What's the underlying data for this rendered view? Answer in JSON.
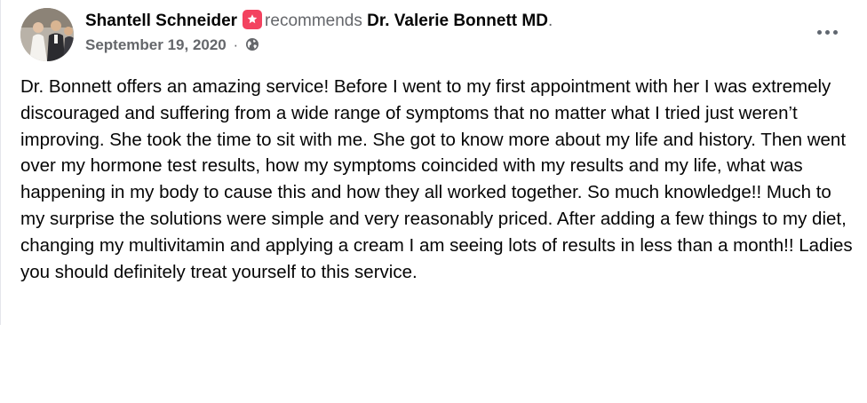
{
  "post": {
    "author": "Shantell Schneider",
    "recommend_verb": "recommends",
    "page_name": "Dr. Valerie Bonnett MD",
    "page_suffix": ".",
    "date": "September 19, 2020",
    "separator": "·",
    "audience_icon": "globe-icon",
    "recommend_badge_icon": "star-recommendation-icon",
    "badge_color": "#f3425f",
    "more_icon": "ellipsis-icon",
    "body": "Dr. Bonnett offers an amazing service! Before I went to my first appointment with her I was extremely discouraged and suffering from a wide range of symptoms that no matter what I tried just weren’t improving. She took the time to sit with me. She got to know more about my life and history. Then went over my hormone test results, how my symptoms coincided with my results and my life, what was happening in my body to cause this and how they all worked together. So much knowledge!! Much to my surprise the solutions were simple and very reasonably priced. After adding a few things to my diet, changing my multivitamin and applying a cream I am seeing lots of results in less than a month!! Ladies you should definitely treat yourself to this service."
  }
}
